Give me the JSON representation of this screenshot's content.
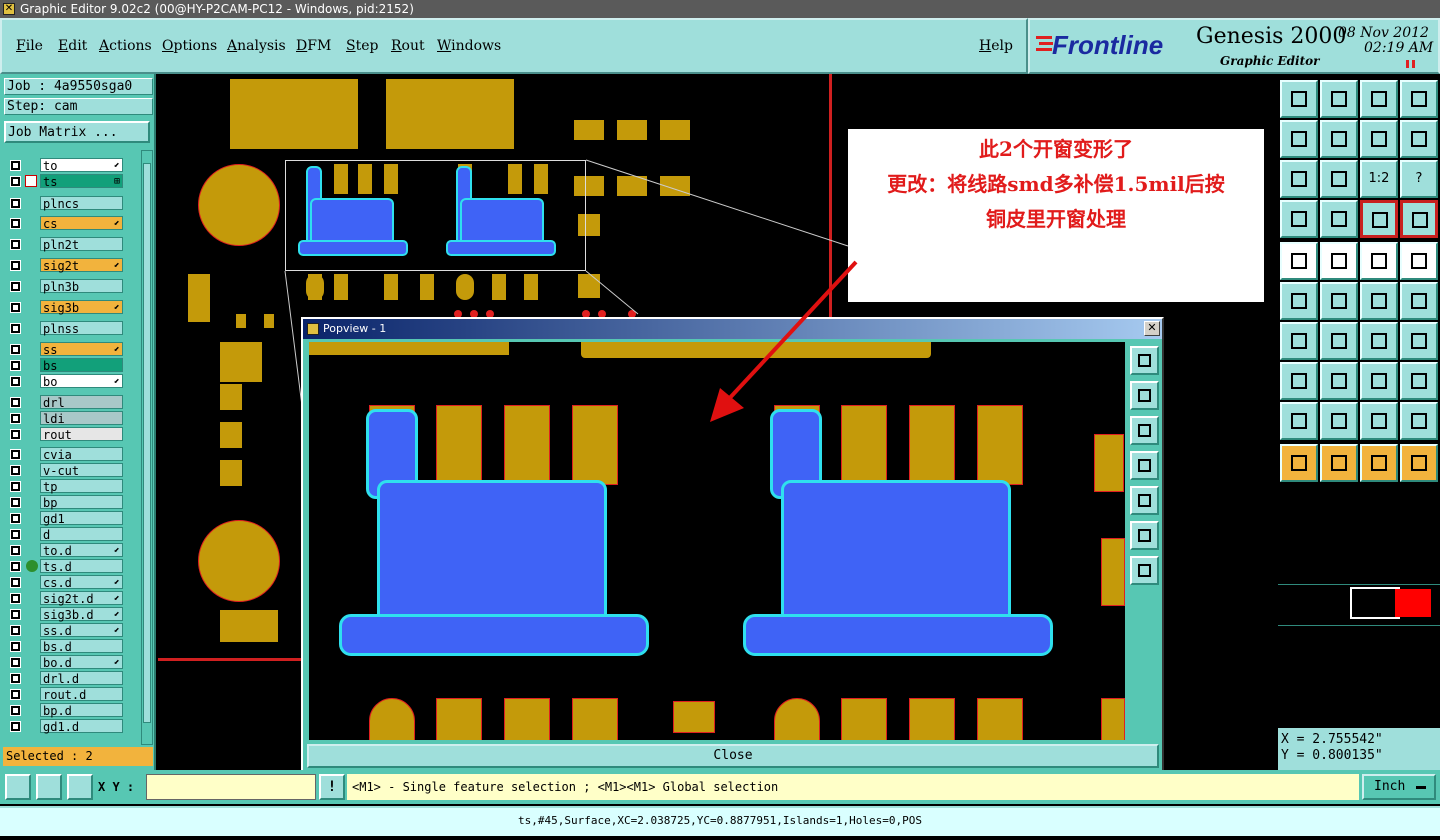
{
  "window": {
    "title": "Graphic Editor 9.02c2 (00@HY-P2CAM-PC12 - Windows, pid:2152)"
  },
  "menu": {
    "items": [
      "File",
      "Edit",
      "Actions",
      "Options",
      "Analysis",
      "DFM",
      "Step",
      "Rout",
      "Windows"
    ],
    "help": "Help"
  },
  "brand": {
    "logo": "Frontline",
    "product": "Genesis 2000",
    "subtitle": "Graphic Editor",
    "date": "08 Nov 2012",
    "time": "02:19 AM"
  },
  "job": {
    "job_label": "Job : 4a9550sga0",
    "step_label": "Step: cam",
    "matrix_button": "Job Matrix ..."
  },
  "layers": [
    {
      "name": "to",
      "color": "#ffffff",
      "tag": "⬋"
    },
    {
      "name": "ts",
      "color": "#12a07a",
      "tag": "⊞",
      "active": true
    },
    {
      "name": "plncs",
      "color": "#9fdfdb",
      "tag": ""
    },
    {
      "name": "cs",
      "color": "#f2b33d",
      "tag": "⬋"
    },
    {
      "name": "pln2t",
      "color": "#9fdfdb",
      "tag": ""
    },
    {
      "name": "sig2t",
      "color": "#f2b33d",
      "tag": "⬋"
    },
    {
      "name": "pln3b",
      "color": "#9fdfdb",
      "tag": ""
    },
    {
      "name": "sig3b",
      "color": "#f2b33d",
      "tag": "⬋"
    },
    {
      "name": "plnss",
      "color": "#9fdfdb",
      "tag": ""
    },
    {
      "name": "ss",
      "color": "#f2b33d",
      "tag": "⬋"
    },
    {
      "name": "bs",
      "color": "#12a07a",
      "tag": ""
    },
    {
      "name": "bo",
      "color": "#ffffff",
      "tag": "⬋"
    },
    {
      "name": "drl",
      "color": "#a8c8c8",
      "tag": ""
    },
    {
      "name": "ldi",
      "color": "#a8c8c8",
      "tag": ""
    },
    {
      "name": "rout",
      "color": "#e6e6e6",
      "tag": ""
    },
    {
      "name": "cvia",
      "color": "#9fdfdb",
      "tag": ""
    },
    {
      "name": "v-cut",
      "color": "#9fdfdb",
      "tag": ""
    },
    {
      "name": "tp",
      "color": "#9fdfdb",
      "tag": ""
    },
    {
      "name": "bp",
      "color": "#9fdfdb",
      "tag": ""
    },
    {
      "name": "gd1",
      "color": "#9fdfdb",
      "tag": ""
    },
    {
      "name": "d",
      "color": "#9fdfdb",
      "tag": ""
    },
    {
      "name": "to.d",
      "color": "#9fdfdb",
      "tag": "⬋"
    },
    {
      "name": "ts.d",
      "color": "#9fdfdb",
      "tag": ""
    },
    {
      "name": "cs.d",
      "color": "#9fdfdb",
      "tag": "⬋"
    },
    {
      "name": "sig2t.d",
      "color": "#9fdfdb",
      "tag": "⬋"
    },
    {
      "name": "sig3b.d",
      "color": "#9fdfdb",
      "tag": "⬋"
    },
    {
      "name": "ss.d",
      "color": "#9fdfdb",
      "tag": "⬋"
    },
    {
      "name": "bs.d",
      "color": "#9fdfdb",
      "tag": ""
    },
    {
      "name": "bo.d",
      "color": "#9fdfdb",
      "tag": "⬋"
    },
    {
      "name": "drl.d",
      "color": "#9fdfdb",
      "tag": ""
    },
    {
      "name": "rout.d",
      "color": "#9fdfdb",
      "tag": ""
    },
    {
      "name": "bp.d",
      "color": "#9fdfdb",
      "tag": ""
    },
    {
      "name": "gd1.d",
      "color": "#9fdfdb",
      "tag": ""
    }
  ],
  "selected": "Selected : 2",
  "callout": {
    "line1": "此2个开窗变形了",
    "line2": "更改：将线路smd多补偿1.5mil后按",
    "line3": "铜皮里开窗处理"
  },
  "popview": {
    "title": "Popview - 1",
    "close_x": "✕",
    "close_button": "Close"
  },
  "coords": {
    "x": "X = 2.755542\"",
    "y": "Y = 0.800135\""
  },
  "bottom": {
    "xy_label": "X Y :",
    "xy_value": "",
    "info_icon": "!",
    "message": "<M1> - Single feature selection ; <M1><M1> Global selection",
    "unit": "Inch"
  },
  "status": {
    "text": "ts,#45,Surface,XC=2.038725,YC=0.8877951,Islands=1,Holes=0,POS"
  },
  "toolbar_icons": [
    "open-icon",
    "save-icon",
    "home-icon",
    "window-icon",
    "import-icon",
    "export-icon",
    "rotate-icon",
    "snap-icon",
    "zoom-fit-icon",
    "zoom-icon",
    "ratio-icon",
    "help-icon",
    "measure-icon",
    "grid-icon",
    "layers-icon",
    "layers-alt-icon",
    "arrow-icon",
    "edit-icon",
    "ruler-icon",
    "select-area-icon",
    "connect-icon",
    "delete-icon",
    "move-icon",
    "add-icon",
    "line-icon",
    "slash-icon",
    "rotate-arc-icon",
    "flip-icon",
    "fill-icon",
    "cut-icon",
    "dimension-icon",
    "shape-icon",
    "triangle-icon",
    "arc-icon",
    "arc-alt-icon",
    "arc-cut-icon",
    "pointer-icon",
    "pointer-box-icon",
    "pointer-alt-icon",
    "route-icon"
  ],
  "toolbar_labels": {
    "ratio": "1:2",
    "help": "?"
  }
}
